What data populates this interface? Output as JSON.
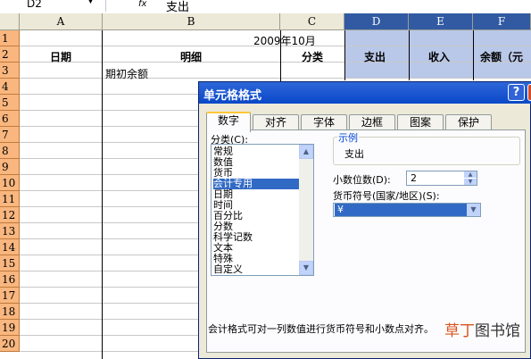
{
  "formula_bar": {
    "name_box": "D2",
    "fx": "fx",
    "content": "支出"
  },
  "columns": [
    {
      "label": "A",
      "selected": false
    },
    {
      "label": "B",
      "selected": false
    },
    {
      "label": "C",
      "selected": false
    },
    {
      "label": "D",
      "selected": true
    },
    {
      "label": "E",
      "selected": true
    },
    {
      "label": "F",
      "selected": true
    }
  ],
  "rows": [
    "1",
    "2",
    "3",
    "4",
    "5",
    "6",
    "7",
    "8",
    "9",
    "10",
    "11",
    "12",
    "13",
    "14",
    "15",
    "16",
    "17",
    "18",
    "19",
    "20"
  ],
  "sheet": {
    "month_title": "2009年10月",
    "headers": {
      "date": "日期",
      "detail": "明细",
      "category": "分类",
      "expense": "支出",
      "income": "收入",
      "balance": "余额（元"
    },
    "opening_balance": "期初余额"
  },
  "dialog": {
    "title": "单元格格式",
    "help": "?",
    "close": "×",
    "tabs": [
      "数字",
      "对齐",
      "字体",
      "边框",
      "图案",
      "保护"
    ],
    "active_tab": "数字",
    "category_label": "分类(C):",
    "categories": [
      "常规",
      "数值",
      "货币",
      "会计专用",
      "日期",
      "时间",
      "百分比",
      "分数",
      "科学记数",
      "文本",
      "特殊",
      "自定义"
    ],
    "selected_category": "会计专用",
    "sample_label": "示例",
    "sample_value": "支出",
    "decimals_label": "小数位数(D):",
    "decimals_value": "2",
    "currency_label": "货币符号(国家/地区)(S):",
    "currency_value": "¥",
    "description": "会计格式可对一列数值进行货币符号和小数点对齐。"
  },
  "watermark": {
    "part1": "草丁",
    "part2": "图书馆"
  },
  "colors": {
    "selected_header": "#315aa3",
    "row_header": "#f9b67e",
    "selection": "#316ac5",
    "titlebar": "#0a48c8"
  }
}
